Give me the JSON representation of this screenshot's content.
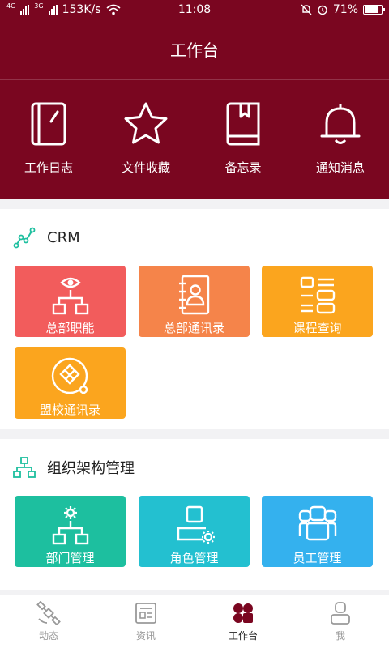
{
  "status": {
    "net1": "4G",
    "net2": "3G",
    "speed": "153K/s",
    "time": "11:08",
    "battery": "71%",
    "battery_level": 0.71
  },
  "header": {
    "title": "工作台",
    "quick_items": [
      {
        "label": "工作日志",
        "icon": "notebook-icon"
      },
      {
        "label": "文件收藏",
        "icon": "star-icon"
      },
      {
        "label": "备忘录",
        "icon": "memo-book-icon"
      },
      {
        "label": "通知消息",
        "icon": "bell-icon"
      }
    ]
  },
  "crm": {
    "title": "CRM",
    "tiles": [
      {
        "label": "总部职能",
        "color": "#f25c5c",
        "icon": "org-eye-icon"
      },
      {
        "label": "总部通讯录",
        "color": "#f5844a",
        "icon": "address-book-icon"
      },
      {
        "label": "课程查询",
        "color": "#fba51e",
        "icon": "course-list-icon"
      },
      {
        "label": "盟校通讯录",
        "color": "#fba51e",
        "icon": "league-school-icon"
      }
    ]
  },
  "org": {
    "title": "组织架构管理",
    "tiles": [
      {
        "label": "部门管理",
        "color": "#1dbf9f",
        "icon": "department-icon"
      },
      {
        "label": "角色管理",
        "color": "#23c0d0",
        "icon": "role-gear-icon"
      },
      {
        "label": "员工管理",
        "color": "#34b1ee",
        "icon": "staff-icon"
      }
    ]
  },
  "tabs": [
    {
      "label": "动态",
      "icon": "satellite-icon"
    },
    {
      "label": "资讯",
      "icon": "news-icon"
    },
    {
      "label": "工作台",
      "icon": "workbench-icon",
      "active": true
    },
    {
      "label": "我",
      "icon": "person-icon"
    }
  ],
  "colors": {
    "brand": "#7a0620",
    "section_icon": "#1dbf9f"
  }
}
